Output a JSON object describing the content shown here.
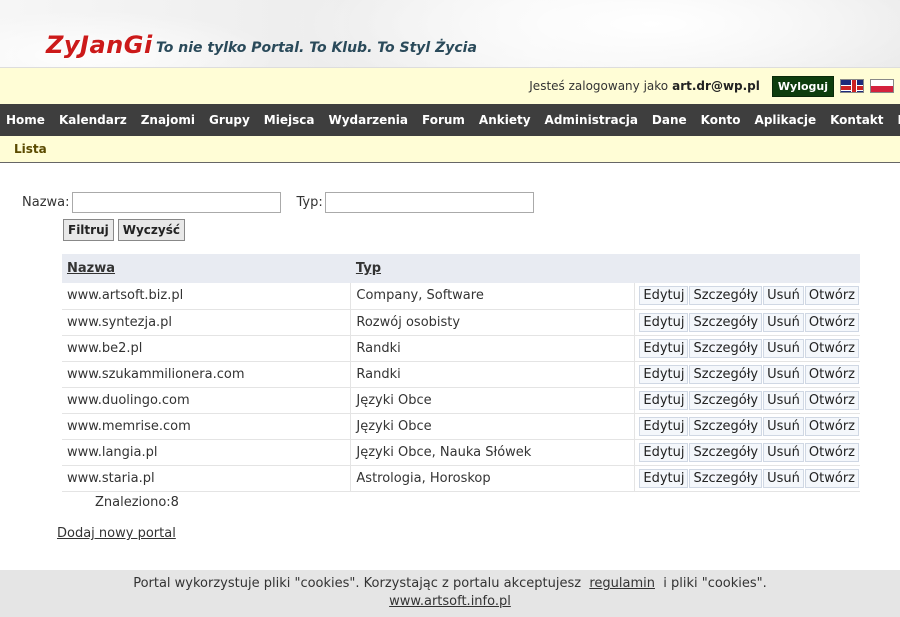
{
  "header": {
    "logo": "ZyJanGi",
    "tagline": "To nie tylko Portal. To Klub. To Styl Życia"
  },
  "userbar": {
    "logged_text": "Jesteś zalogowany jako",
    "user": "art.dr@wp.pl",
    "logout_label": "Wyloguj"
  },
  "nav": {
    "items": [
      "Home",
      "Kalendarz",
      "Znajomi",
      "Grupy",
      "Miejsca",
      "Wydarzenia",
      "Forum",
      "Ankiety",
      "Administracja",
      "Dane",
      "Konto",
      "Aplikacje",
      "Kontakt",
      "Info"
    ]
  },
  "subnav": {
    "label": "Lista"
  },
  "filter": {
    "name_label": "Nazwa:",
    "name_value": "",
    "type_label": "Typ:",
    "type_value": "",
    "filter_button": "Filtruj",
    "clear_button": "Wyczyść"
  },
  "table": {
    "headers": [
      "Nazwa",
      "Typ"
    ],
    "actions": [
      "Edytuj",
      "Szczegóły",
      "Usuń",
      "Otwórz"
    ],
    "rows": [
      {
        "name": "www.artsoft.biz.pl",
        "type": "Company, Software"
      },
      {
        "name": "www.syntezja.pl",
        "type": "Rozwój osobisty"
      },
      {
        "name": "www.be2.pl",
        "type": "Randki"
      },
      {
        "name": "www.szukammilionera.com",
        "type": "Randki"
      },
      {
        "name": "www.duolingo.com",
        "type": "Języki Obce"
      },
      {
        "name": "www.memrise.com",
        "type": "Języki Obce"
      },
      {
        "name": "www.langia.pl",
        "type": "Języki Obce, Nauka Słówek"
      },
      {
        "name": "www.staria.pl",
        "type": "Astrologia, Horoskop"
      }
    ]
  },
  "found_text": "Znaleziono:8",
  "add_link": "Dodaj nowy portal",
  "footer": {
    "text_before": "Portal wykorzystuje pliki \"cookies\". Korzystając z portalu akceptujesz",
    "link": "regulamin",
    "text_after": "i pliki \"cookies\".",
    "site_link": "www.artsoft.info.pl"
  }
}
